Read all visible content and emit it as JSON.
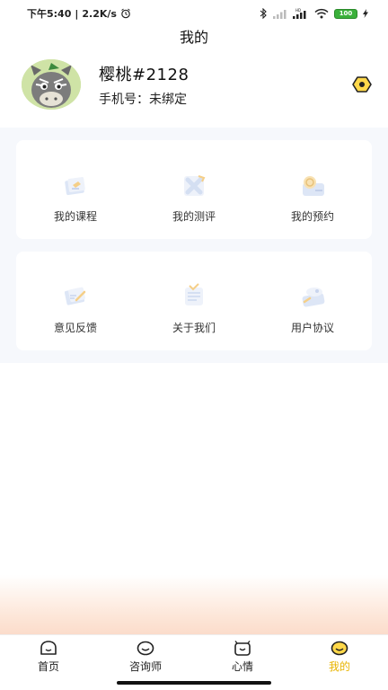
{
  "status_bar": {
    "time": "下午5:40",
    "speed": "2.2K/s",
    "battery": "100"
  },
  "page": {
    "title": "我的"
  },
  "profile": {
    "name": "樱桃#2128",
    "phone": "手机号：未绑定"
  },
  "menu_rows": [
    [
      {
        "label": "我的课程",
        "icon": "course-icon"
      },
      {
        "label": "我的测评",
        "icon": "assessment-icon"
      },
      {
        "label": "我的预约",
        "icon": "appointment-icon"
      }
    ],
    [
      {
        "label": "意见反馈",
        "icon": "feedback-icon"
      },
      {
        "label": "关于我们",
        "icon": "about-icon"
      },
      {
        "label": "用户协议",
        "icon": "agreement-icon"
      }
    ]
  ],
  "tabbar": {
    "items": [
      {
        "label": "首页",
        "icon": "home-face-icon"
      },
      {
        "label": "咨询师",
        "icon": "counselor-face-icon"
      },
      {
        "label": "心情",
        "icon": "mood-face-icon"
      },
      {
        "label": "我的",
        "icon": "mine-face-icon",
        "active": true
      }
    ]
  },
  "colors": {
    "accent": "#e8b400",
    "page_bg": "#f6f8fc",
    "card_bg": "#ffffff"
  }
}
